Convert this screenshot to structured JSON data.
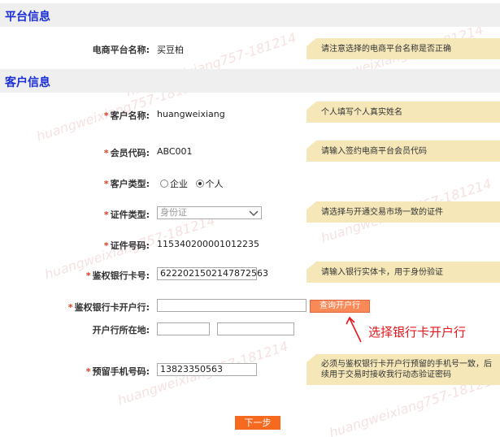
{
  "platform_section": {
    "title": "平台信息",
    "platform_name_label": "电商平台名称:",
    "platform_name_value": "买豆柏",
    "platform_name_hint": "请注意选择的电商平台名称是否正确"
  },
  "customer_section": {
    "title": "客户信息",
    "name_label": "客户名称:",
    "name_value": "huangweixiang",
    "name_hint": "个人填写个人真实姓名",
    "member_code_label": "会员代码:",
    "member_code_value": "ABC001",
    "member_code_hint": "请输入签约电商平台会员代码",
    "customer_type_label": "客户类型:",
    "customer_type_options": [
      "企业",
      "个人"
    ],
    "customer_type_selected": "个人",
    "id_type_label": "证件类型:",
    "id_type_value": "身份证",
    "id_type_hint": "请选择与开通交易市场一致的证件",
    "id_number_label": "证件号码:",
    "id_number_value": "115340200001012235",
    "auth_card_label": "鉴权银行卡号:",
    "auth_card_value": "6222021502147872563",
    "auth_card_hint": "请输入银行实体卡，用于身份验证",
    "bank_branch_label": "鉴权银行卡开户行:",
    "bank_branch_value": "",
    "query_branch_button": "查询开户行",
    "branch_location_label": "开户行所在地:",
    "branch_location_province": "",
    "branch_location_city": "",
    "phone_label": "预留手机号码:",
    "phone_value": "13823350563",
    "phone_hint": "必须与鉴权银行卡开户行预留的手机号一致，后续用于交易时接收我行动态验证密码",
    "required_mark": "*"
  },
  "annotation_text": "选择银行卡开户行",
  "next_button": "下一步",
  "watermark_text": "huangweixiang757-181214",
  "colors": {
    "section_title": "#1a2fd6",
    "hint_bg": "#f5e7b8",
    "required": "#e03a1e",
    "button_orange": "#f56a1f",
    "query_button": "#f98a58",
    "annotation_red": "#e8161c"
  }
}
